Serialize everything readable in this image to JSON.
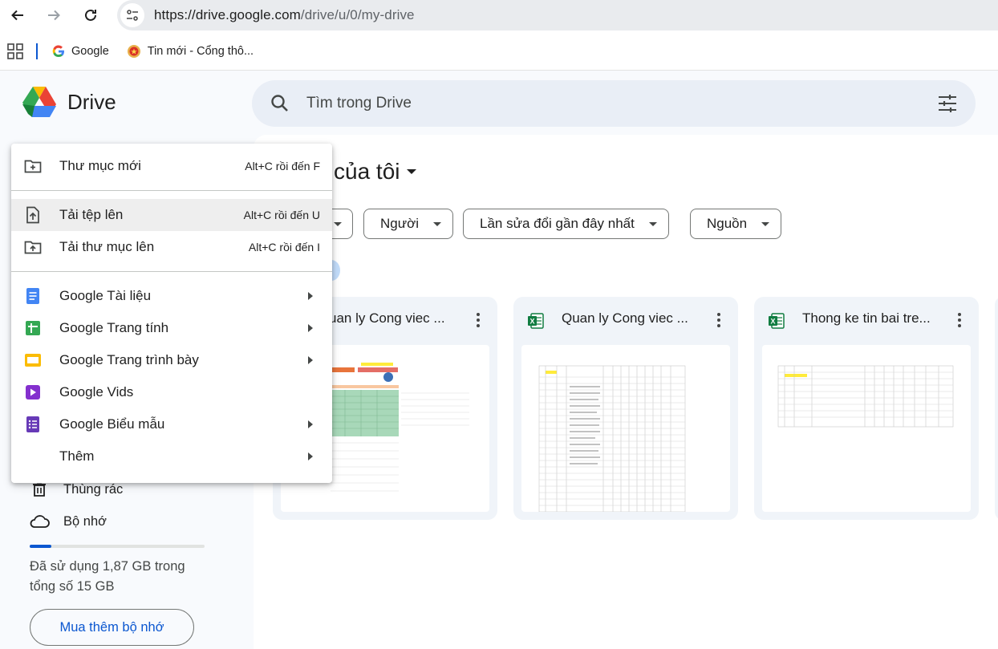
{
  "browser": {
    "url_host": "https://drive.google.com",
    "url_path": "/drive/u/0/my-drive",
    "bookmarks": [
      {
        "label": "Google",
        "icon": "google-g-icon"
      },
      {
        "label": "Tin mới - Cổng thô...",
        "icon": "government-emblem-icon"
      }
    ]
  },
  "header": {
    "app_name": "Drive",
    "search_placeholder": "Tìm trong Drive"
  },
  "main": {
    "title": "của tôi",
    "filters": [
      "Người",
      "Lần sửa đổi gần đây nhất",
      "Nguồn"
    ],
    "files": [
      {
        "name": "uan ly Cong viec ...",
        "icon": "excel-icon"
      },
      {
        "name": "Quan ly Cong viec ...",
        "icon": "excel-icon"
      },
      {
        "name": "Thong ke tin bai tre...",
        "icon": "excel-icon"
      }
    ]
  },
  "sidebar": {
    "trash_label": "Thùng rác",
    "storage_label": "Bộ nhớ",
    "storage_used_fraction": 0.125,
    "storage_text": "Đã sử dụng 1,87 GB trong tổng số 15 GB",
    "buy_label": "Mua thêm bộ nhớ"
  },
  "menu": {
    "new_folder": {
      "label": "Thư mục mới",
      "shortcut": "Alt+C rồi đến F"
    },
    "upload_file": {
      "label": "Tải tệp lên",
      "shortcut": "Alt+C rồi đến U"
    },
    "upload_folder": {
      "label": "Tải thư mục lên",
      "shortcut": "Alt+C rồi đến I"
    },
    "apps": [
      {
        "label": "Google Tài liệu",
        "icon": "google-docs-icon",
        "submenu": true
      },
      {
        "label": "Google Trang tính",
        "icon": "google-sheets-icon",
        "submenu": true
      },
      {
        "label": "Google Trang trình bày",
        "icon": "google-slides-icon",
        "submenu": true
      },
      {
        "label": "Google Vids",
        "icon": "google-vids-icon",
        "submenu": false
      },
      {
        "label": "Google Biểu mẫu",
        "icon": "google-forms-icon",
        "submenu": true
      },
      {
        "label": "Thêm",
        "icon": "",
        "submenu": true
      }
    ]
  },
  "colors": {
    "accent": "#0b57d0",
    "docs": "#4285f4",
    "sheets": "#34a853",
    "slides": "#fbbc04",
    "vids": "#8430ce",
    "forms": "#673ab7",
    "excel": "#107c41"
  }
}
